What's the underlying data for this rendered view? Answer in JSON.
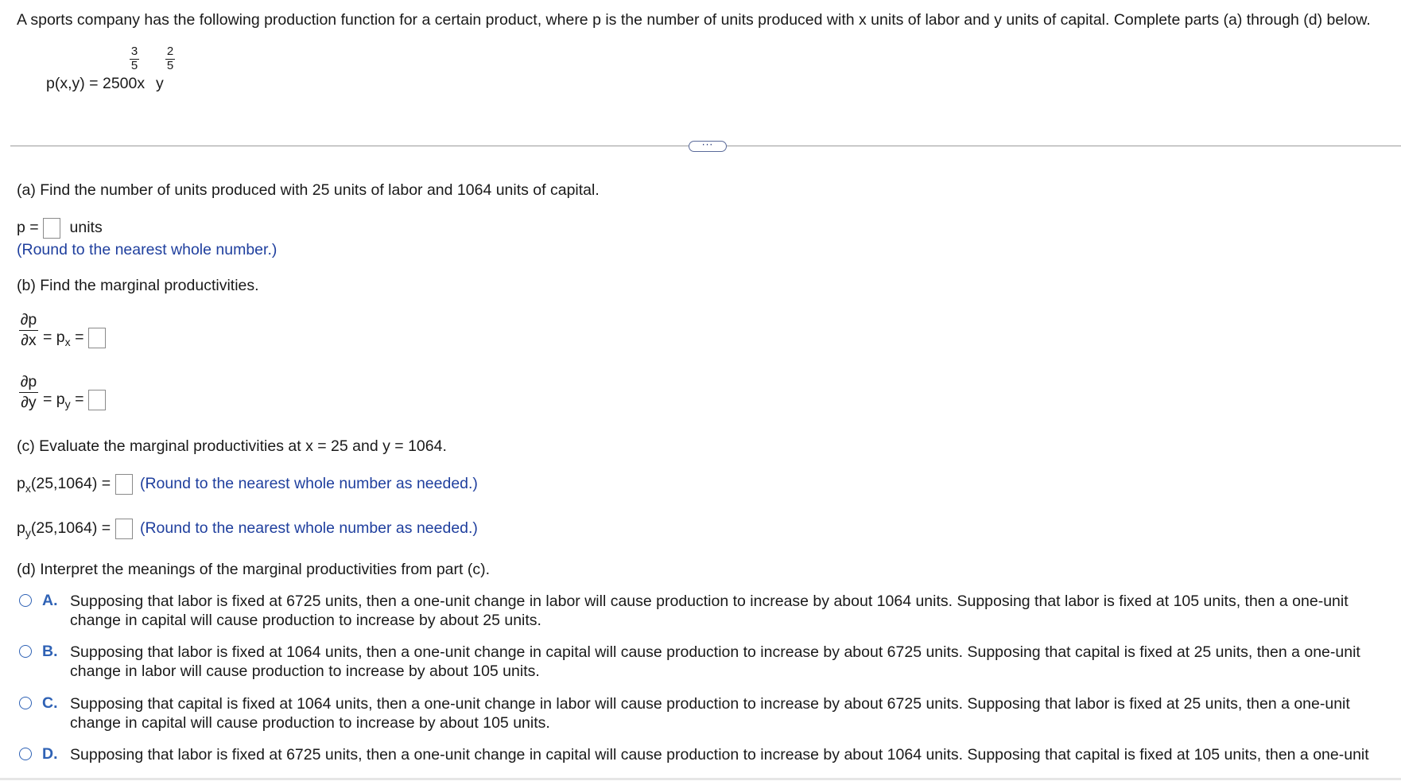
{
  "question": {
    "intro": "A sports company has the following production function for a certain product, where p is the number of units produced with x units of labor and y units of capital. Complete parts (a) through (d) below.",
    "formula": {
      "lhs": "p(x,y) = 2500x",
      "x_exp_num": "3",
      "x_exp_den": "5",
      "y_var": "y",
      "y_exp_num": "2",
      "y_exp_den": "5"
    },
    "more_button": "···"
  },
  "part_a": {
    "prompt": "(a) Find the number of units produced with 25 units of labor and 1064 units of capital.",
    "p_label": "p =",
    "units": "units",
    "hint": "(Round to the nearest whole number.)"
  },
  "part_b": {
    "prompt": "(b) Find the marginal productivities.",
    "dx_top": "∂p",
    "dx_bot": "∂x",
    "dx_eq": "= p",
    "dx_sub": "x",
    "dx_eq2": " =",
    "dy_top": "∂p",
    "dy_bot": "∂y",
    "dy_eq": "= p",
    "dy_sub": "y",
    "dy_eq2": " ="
  },
  "part_c": {
    "prompt": "(c) Evaluate the marginal productivities at x = 25 and y = 1064.",
    "px_p": "p",
    "px_sub": "x",
    "px_args": "(25,1064) =",
    "px_hint": "(Round to the nearest whole number as needed.)",
    "py_p": "p",
    "py_sub": "y",
    "py_args": "(25,1064) =",
    "py_hint": "(Round to the nearest whole number as needed.)"
  },
  "part_d": {
    "prompt": "(d) Interpret the meanings of the marginal productivities from part (c).",
    "options": [
      {
        "letter": "A.",
        "text": "Supposing that labor is fixed at 6725 units, then a one-unit change in labor will cause production to increase by about 1064 units. Supposing that labor is fixed at 105 units, then a one-unit change in capital will cause production to increase by about 25 units."
      },
      {
        "letter": "B.",
        "text": "Supposing that labor is fixed at 1064 units, then a one-unit change in capital will cause production to increase by about 6725 units. Supposing that capital is fixed at 25 units, then a one-unit change in labor will cause production to increase by about 105 units."
      },
      {
        "letter": "C.",
        "text": "Supposing that capital is fixed at 1064 units, then a one-unit change in labor will cause production to increase by about 6725 units. Supposing that labor is fixed at 25 units, then a one-unit change in capital will cause production to increase by about 105 units."
      },
      {
        "letter": "D.",
        "text": "Supposing that labor is fixed at 6725 units, then a one-unit change in capital will cause production to increase by about 1064 units. Supposing that capital is fixed at 105 units, then a one-unit"
      }
    ]
  },
  "colors": {
    "hint_blue": "#1f3f9e",
    "option_blue": "#2f62b5"
  }
}
